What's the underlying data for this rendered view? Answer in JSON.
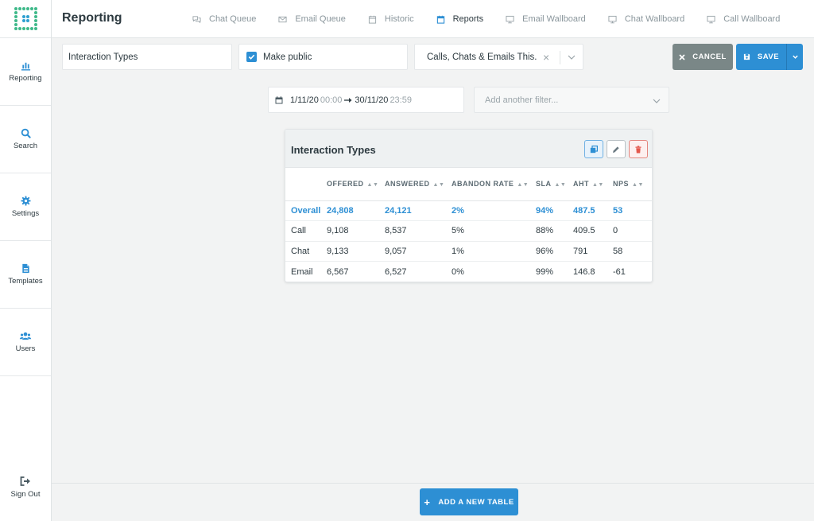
{
  "header": {
    "title": "Reporting",
    "tabs": [
      {
        "label": "Chat Queue",
        "icon": "chat-icon",
        "active": false
      },
      {
        "label": "Email Queue",
        "icon": "envelope-icon",
        "active": false
      },
      {
        "label": "Historic",
        "icon": "calendar-icon",
        "active": false
      },
      {
        "label": "Reports",
        "icon": "calendar-icon",
        "active": true
      },
      {
        "label": "Email Wallboard",
        "icon": "monitor-icon",
        "active": false
      },
      {
        "label": "Chat Wallboard",
        "icon": "monitor-icon",
        "active": false
      },
      {
        "label": "Call Wallboard",
        "icon": "monitor-icon",
        "active": false
      }
    ]
  },
  "sidebar": {
    "items": [
      {
        "label": "Reporting",
        "icon": "bar-chart-icon"
      },
      {
        "label": "Search",
        "icon": "search-icon"
      },
      {
        "label": "Settings",
        "icon": "gear-icon"
      },
      {
        "label": "Templates",
        "icon": "document-icon"
      },
      {
        "label": "Users",
        "icon": "users-icon"
      }
    ],
    "signout_label": "Sign Out"
  },
  "toolbar": {
    "report_name": "Interaction Types",
    "make_public_label": "Make public",
    "make_public_checked": true,
    "data_source": "Calls, Chats & Emails This.",
    "cancel_label": "CANCEL",
    "save_label": "SAVE"
  },
  "filters": {
    "date_from": "1/11/20",
    "time_from": "00:00",
    "date_to": "30/11/20",
    "time_to": "23:59",
    "add_filter_placeholder": "Add another filter..."
  },
  "table": {
    "title": "Interaction Types",
    "columns": [
      "OFFERED",
      "ANSWERED",
      "ABANDON RATE",
      "SLA",
      "AHT",
      "NPS"
    ],
    "rows": [
      {
        "label": "Overall",
        "values": [
          "24,808",
          "24,121",
          "2%",
          "94%",
          "487.5",
          "53"
        ]
      },
      {
        "label": "Call",
        "values": [
          "9,108",
          "8,537",
          "5%",
          "88%",
          "409.5",
          "0"
        ]
      },
      {
        "label": "Chat",
        "values": [
          "9,133",
          "9,057",
          "1%",
          "96%",
          "791",
          "58"
        ]
      },
      {
        "label": "Email",
        "values": [
          "6,567",
          "6,527",
          "0%",
          "99%",
          "146.8",
          "-61"
        ]
      }
    ]
  },
  "footer": {
    "add_table_label": "ADD A NEW TABLE"
  },
  "colors": {
    "accent": "#2d8fd4",
    "brand": "#3fb98a",
    "cancel": "#7a8787",
    "danger": "#e4574b"
  }
}
